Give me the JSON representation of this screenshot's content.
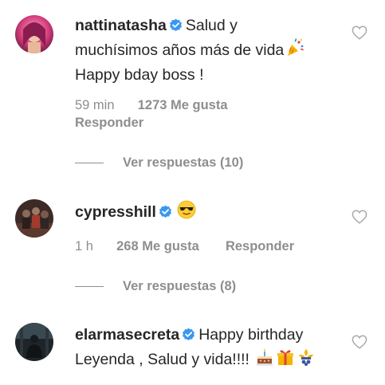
{
  "comments": [
    {
      "username": "nattinatasha",
      "verified": true,
      "text_line1": "Salud y",
      "text_line2": "muchísimos años más de vida",
      "text_line3": "Happy bday boss !",
      "emojis": [
        "party-popper"
      ],
      "time": "59 min",
      "likes": "1273 Me gusta",
      "reply_label": "Responder",
      "view_replies": "Ver respuestas (10)"
    },
    {
      "username": "cypresshill",
      "verified": true,
      "text_line1": "",
      "emojis": [
        "sunglasses-face"
      ],
      "time": "1 h",
      "likes": "268 Me gusta",
      "reply_label": "Responder",
      "view_replies": "Ver respuestas (8)"
    },
    {
      "username": "elarmasecreta",
      "verified": true,
      "text_line1": "Happy birthday",
      "text_line2": "Leyenda , Salud y vida!!!!",
      "emojis": [
        "birthday-cake",
        "wrapped-gift",
        "fleur-ornament"
      ]
    }
  ],
  "colors": {
    "text": "#262626",
    "muted": "#8e8e8e",
    "verified": "#3897f0",
    "heart_outline": "#a8a8a8"
  },
  "icons": {
    "like": "heart-outline-icon",
    "verified": "verified-badge-icon"
  }
}
